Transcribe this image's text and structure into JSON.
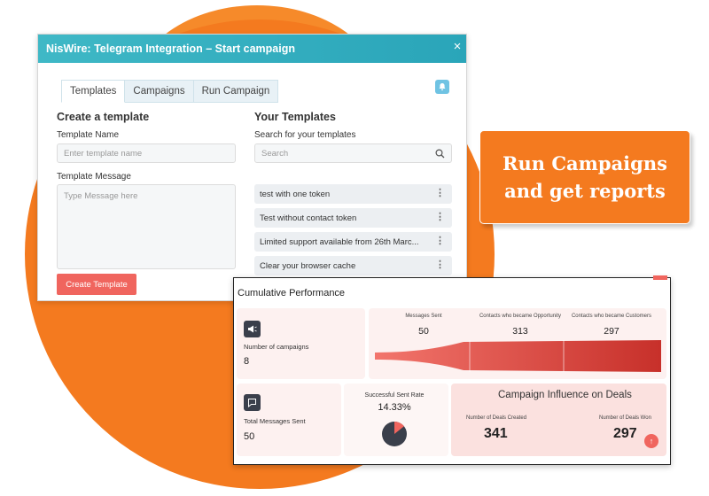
{
  "dialog": {
    "title": "NisWire: Telegram Integration – Start campaign",
    "close_glyph": "×",
    "tabs": [
      "Templates",
      "Campaigns",
      "Run Campaign"
    ],
    "active_tab": "Templates",
    "create": {
      "heading": "Create a template",
      "name_label": "Template Name",
      "name_placeholder": "Enter template name",
      "message_label": "Template Message",
      "message_placeholder": "Type Message here",
      "button_label": "Create Template"
    },
    "your_templates": {
      "heading": "Your Templates",
      "search_label": "Search for your templates",
      "search_placeholder": "Search",
      "items": [
        "test with one token",
        "Test without contact token",
        "Limited support available from 26th Marc...",
        "Clear your browser cache"
      ]
    }
  },
  "callout": {
    "line1": "Run Campaigns",
    "line2": "and get reports"
  },
  "performance": {
    "title": "Cumulative Performance",
    "campaigns_label": "Number of campaigns",
    "campaigns_value": "8",
    "funnel": {
      "columns": [
        {
          "label": "Messages Sent",
          "value": "50"
        },
        {
          "label": "Contacts who became Opportunity",
          "value": "313"
        },
        {
          "label": "Contacts who became Customers",
          "value": "297"
        }
      ]
    },
    "total_messages_label": "Total Messages Sent",
    "total_messages_value": "50",
    "sent_rate_label": "Successful Sent Rate",
    "sent_rate_value": "14.33%",
    "sent_rate_fraction": 0.1433,
    "influence": {
      "title": "Campaign Influence on Deals",
      "created_label": "Number of Deals Created",
      "created_value": "341",
      "won_label": "Number of Deals Won",
      "won_value": "297"
    }
  },
  "colors": {
    "brand_orange": "#f47a1f",
    "header_teal": "#2aa5b9",
    "accent_red": "#f0655e",
    "funnel_dark": "#c7302a"
  }
}
